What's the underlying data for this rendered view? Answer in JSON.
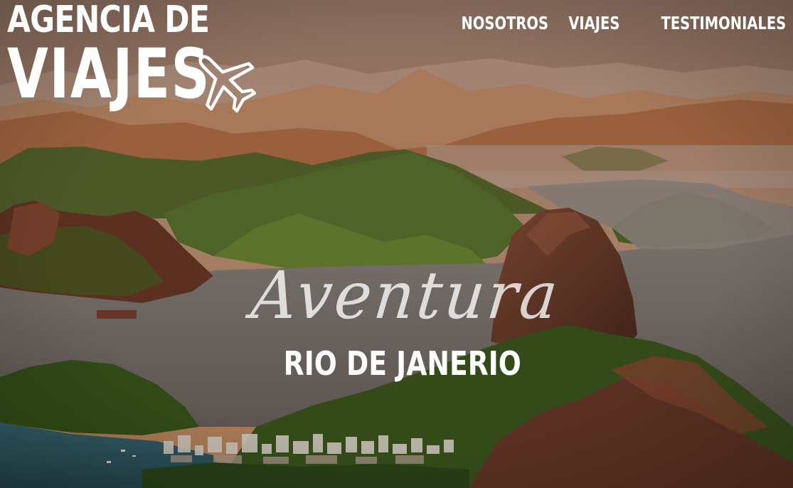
{
  "header": {
    "logo": {
      "line1": "AGENCIA DE",
      "line2": "VIAJES",
      "icon": "airplane-icon"
    },
    "nav": [
      {
        "label": "NOSOTROS"
      },
      {
        "label": "VIAJES"
      },
      {
        "label": "TESTIMONIALES"
      }
    ]
  },
  "hero": {
    "tagline": "Aventura",
    "destination": "RIO DE JANERIO",
    "background": "rio-de-janeiro-landscape-photo"
  },
  "colors": {
    "text": "#ffffff",
    "sky": "#b48a73",
    "water": "#8c7a70",
    "vegetation": "#4f6a2c"
  }
}
